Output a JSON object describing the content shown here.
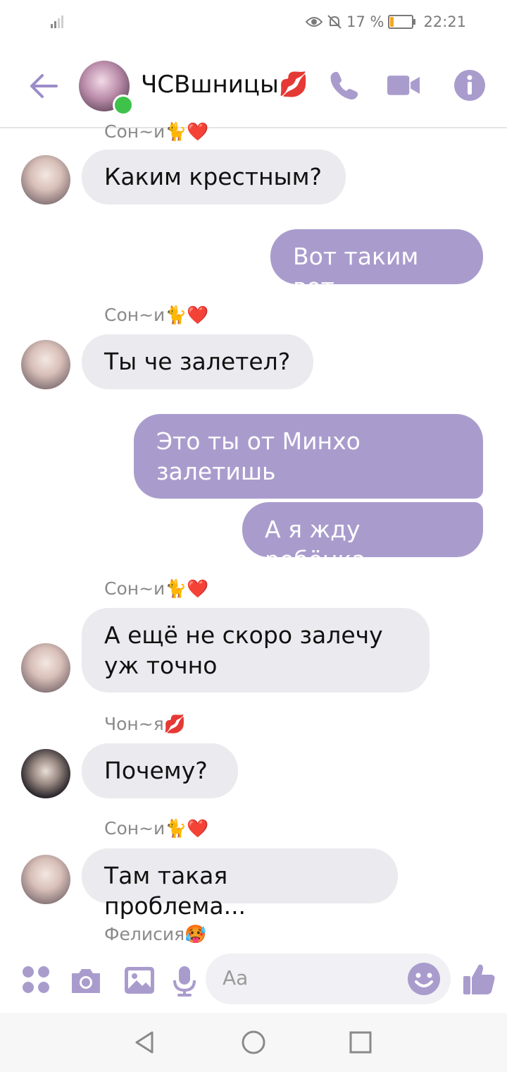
{
  "status_bar": {
    "battery": "17 %",
    "battery_level": 0.17,
    "time": "22:21",
    "battery_color": "#f5a623"
  },
  "header": {
    "title": "ЧСВшницы💋"
  },
  "messages": [
    {
      "sender": "Сон~и🐈❤️"
    },
    {
      "text": "Каким крестным?"
    },
    {
      "text": "Вот таким вот"
    },
    {
      "sender": "Сон~и🐈❤️"
    },
    {
      "text": "Ты че залетел?"
    },
    {
      "text": "Это ты от Минхо\nзалетишь"
    },
    {
      "text": "А я жду ребёнка"
    },
    {
      "sender": "Сон~и🐈❤️"
    },
    {
      "text": "А ещё не скоро залечу\nуж точно"
    },
    {
      "sender": "Чон~я💋"
    },
    {
      "text": "Почему?"
    },
    {
      "sender": "Сон~и🐈❤️"
    },
    {
      "text": "Там такая проблема..."
    },
    {
      "sender": "Фелисия🥵"
    }
  ],
  "input": {
    "placeholder": "Aa"
  },
  "icons": {
    "back": "arrow-left-icon",
    "call": "phone-icon",
    "video": "video-camera-icon",
    "info": "info-icon",
    "apps": "apps-grid-icon",
    "camera": "camera-icon",
    "gallery": "image-icon",
    "mic": "microphone-icon",
    "emoji": "smiley-icon",
    "like": "thumbs-up-icon"
  },
  "colors": {
    "accent": "#a99ccd",
    "incoming_bubble": "#ebeaee",
    "online": "#3ec24a"
  }
}
